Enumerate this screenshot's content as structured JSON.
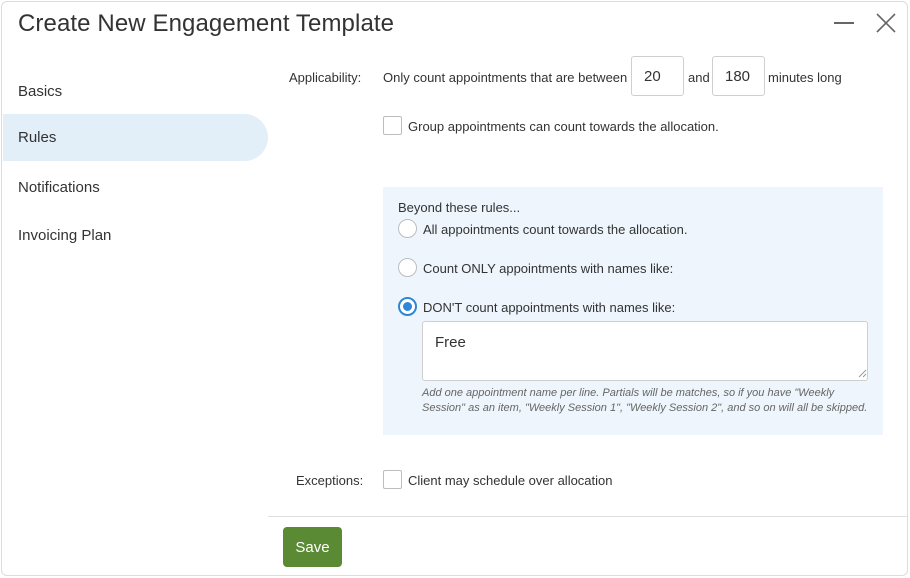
{
  "dialog": {
    "title": "Create New Engagement Template",
    "minimize_icon": "minimize-icon",
    "close_icon": "close-icon"
  },
  "nav": {
    "items": [
      {
        "label": "Basics",
        "active": false
      },
      {
        "label": "Rules",
        "active": true
      },
      {
        "label": "Notifications",
        "active": false
      },
      {
        "label": "Invoicing Plan",
        "active": false
      }
    ]
  },
  "applicability": {
    "label": "Applicability:",
    "prefix_text": "Only count appointments that are between",
    "min_value": "20",
    "and_text": "and",
    "max_value": "180",
    "suffix_text": "minutes long",
    "group_checkbox_label": "Group appointments can count towards the allocation.",
    "group_checked": false
  },
  "rules": {
    "heading": "Beyond these rules...",
    "options": [
      {
        "label": "All appointments count towards the allocation.",
        "checked": false
      },
      {
        "label": "Count ONLY appointments with names like:",
        "checked": false
      },
      {
        "label": "DON'T count appointments with names like:",
        "checked": true
      }
    ],
    "names_value": "Free",
    "hint": "Add one appointment name per line. Partials will be matches, so if you have \"Weekly Session\" as an item, \"Weekly Session 1\", \"Weekly Session 2\", and so on will all be skipped."
  },
  "exceptions": {
    "label": "Exceptions:",
    "checkbox_label": "Client may schedule over allocation",
    "checked": false
  },
  "footer": {
    "save_label": "Save"
  },
  "colors": {
    "accent": "#2f86d4",
    "active_nav_bg": "#e2eff9",
    "rules_box_bg": "#eef5fc",
    "save_button": "#5a8a33"
  }
}
